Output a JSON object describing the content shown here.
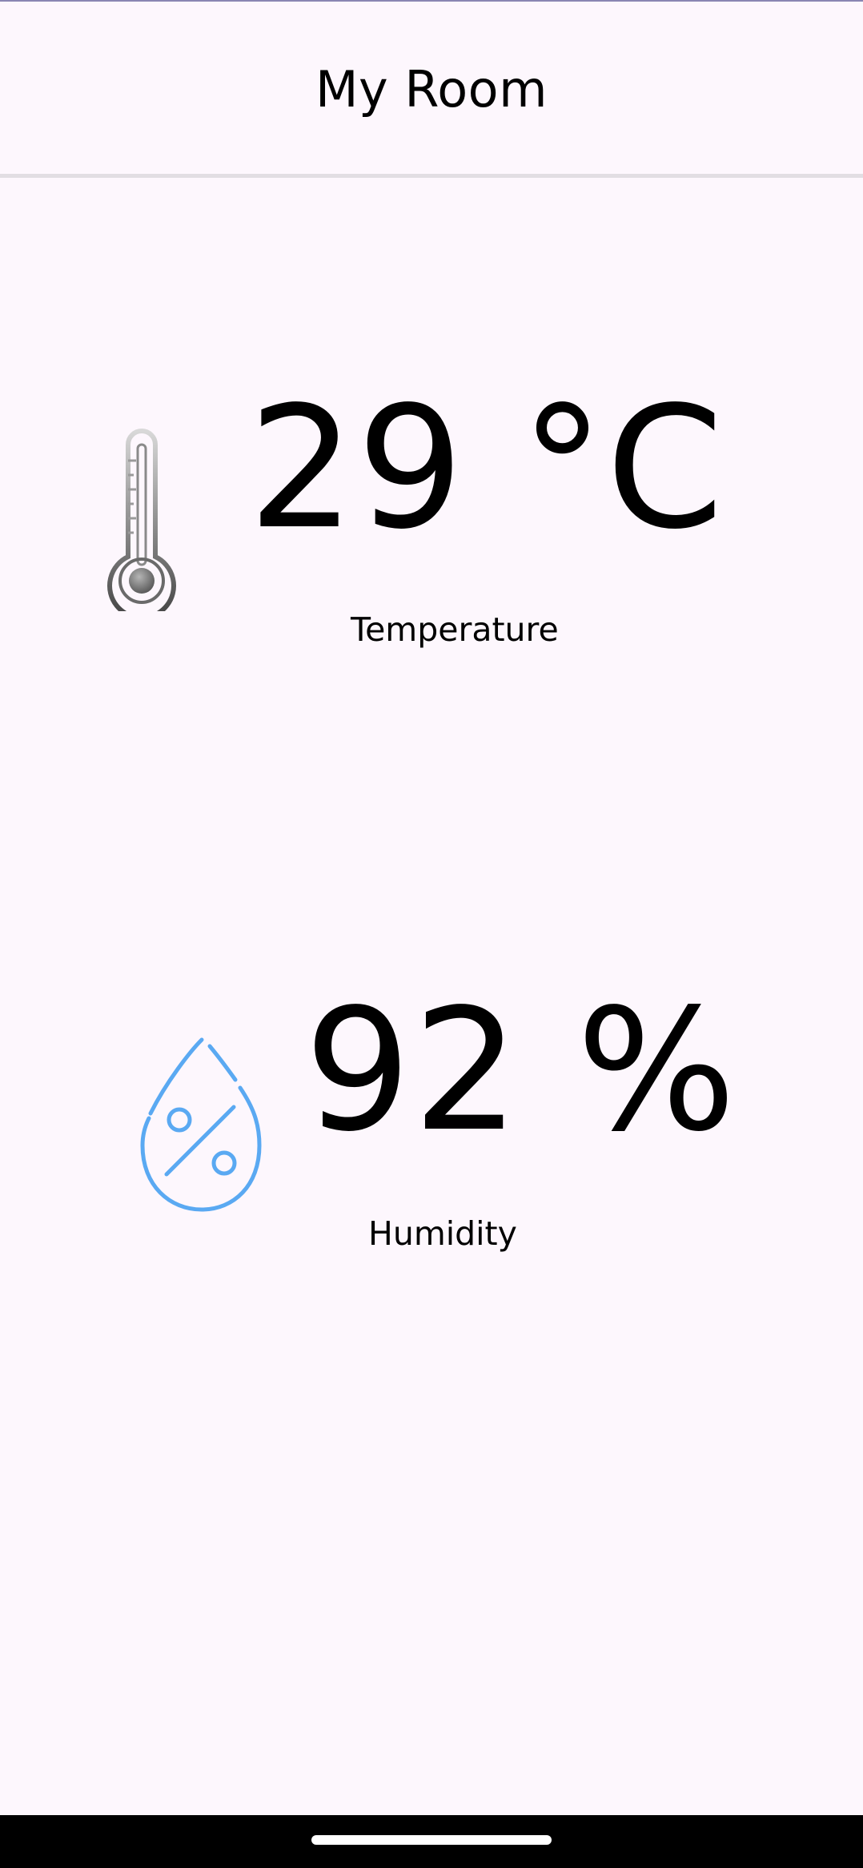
{
  "app": {
    "title": "My Room"
  },
  "temperature": {
    "value_text": "29 °C",
    "label": "Temperature",
    "icon": "thermometer-icon",
    "icon_color": "#777777"
  },
  "humidity": {
    "value_text": "92 %",
    "label": "Humidity",
    "icon": "humidity-drop-icon",
    "icon_color": "#5aa9f2"
  },
  "colors": {
    "background": "#fdf7fd",
    "text": "#000000",
    "divider": "#e2dee3",
    "nav_bar": "#000000"
  }
}
